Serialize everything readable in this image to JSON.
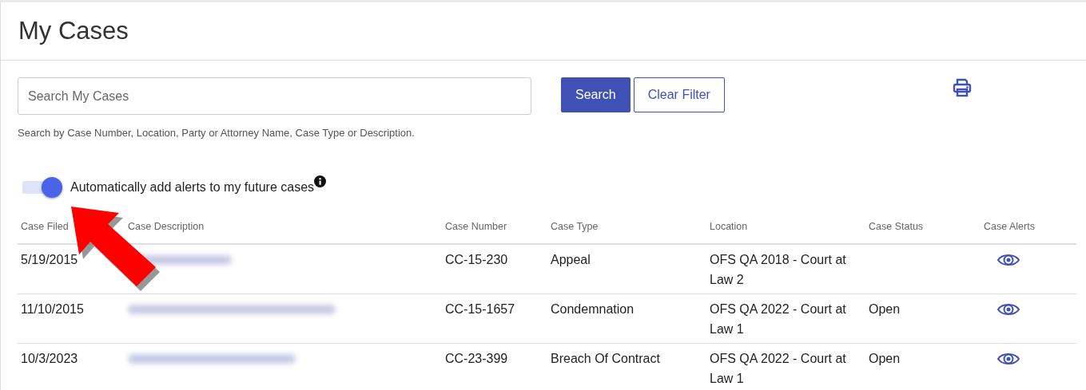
{
  "page": {
    "title": "My Cases"
  },
  "search": {
    "placeholder": "Search My Cases",
    "hint": "Search by Case Number, Location, Party or Attorney Name, Case Type or Description."
  },
  "buttons": [
    {
      "label": "Search",
      "kind": "primary"
    },
    {
      "label": "Clear Filter",
      "kind": "outline"
    }
  ],
  "alerts_toggle": {
    "label": "Automatically add alerts to my future cases",
    "on": true
  },
  "table": {
    "columns": [
      "Case Filed",
      "Case Description",
      "Case Number",
      "Case Type",
      "Location",
      "Case Status",
      "Case Alerts"
    ],
    "rows": [
      {
        "filed": "5/19/2015",
        "number": "CC-15-230",
        "type": "Appeal",
        "location": "OFS QA 2018 - Court at Law 2"
      },
      {
        "filed": "11/10/2015",
        "number": "CC-15-1657",
        "type": "Condemnation",
        "location": "OFS QA 2022 - Court at Law 1",
        "status": "Open"
      },
      {
        "filed": "10/3/2023",
        "number": "CC-23-399",
        "type": "Breach Of Contract",
        "location": "OFS QA 2022 - Court at Law 1",
        "status": "Open"
      }
    ]
  }
}
